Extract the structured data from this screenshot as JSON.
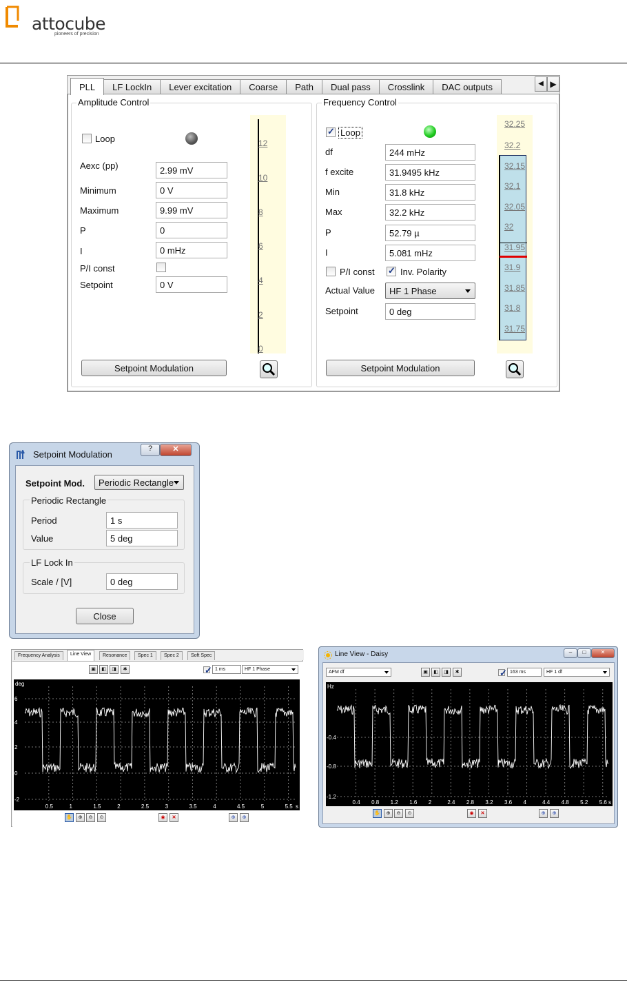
{
  "header": {
    "brand": "attocube",
    "tagline": "pioneers of precision"
  },
  "pll": {
    "tabs": [
      "PLL",
      "LF LockIn",
      "Lever excitation",
      "Coarse",
      "Path",
      "Dual pass",
      "Crosslink",
      "DAC outputs"
    ],
    "amp": {
      "title": "Amplitude Control",
      "loop": "Loop",
      "aexc": "Aexc (pp)",
      "aexc_v": "2.99 mV",
      "min": "Minimum",
      "min_v": "0 V",
      "max": "Maximum",
      "max_v": "9.99 mV",
      "p": "P",
      "p_v": "0",
      "i": "I",
      "i_v": "0 mHz",
      "pic": "P/I const",
      "sp": "Setpoint",
      "sp_v": "0 V",
      "mod_btn": "Setpoint Modulation",
      "scale": [
        "12",
        "10",
        "8",
        "6",
        "4",
        "2",
        "0"
      ]
    },
    "freq": {
      "title": "Frequency Control",
      "loop": "Loop",
      "df": "df",
      "df_v": "244 mHz",
      "fex": "f excite",
      "fex_v": "31.9495 kHz",
      "min": "Min",
      "min_v": "31.8 kHz",
      "max": "Max",
      "max_v": "32.2 kHz",
      "p": "P",
      "p_v": "52.79 µ",
      "i": "I",
      "i_v": "5.081 mHz",
      "pic": "P/I const",
      "inv": "Inv. Polarity",
      "actual": "Actual Value",
      "actual_v": "HF 1 Phase",
      "sp": "Setpoint",
      "sp_v": "0 deg",
      "mod_btn": "Setpoint Modulation",
      "scale": [
        "32.25",
        "32.2",
        "32.15",
        "32.1",
        "32.05",
        "32",
        "31.95",
        "31.9",
        "31.85",
        "31.8",
        "31.75"
      ]
    },
    "colors": {
      "led_amp": "#555555",
      "led_freq": "#22cc22",
      "scale_bg": "#fffce0",
      "range_bg": "#bfe0ea"
    }
  },
  "dialog": {
    "title": "Setpoint Modulation",
    "mod_label": "Setpoint Mod.",
    "mod_v": "Periodic Rectangle",
    "g1": "Periodic Rectangle",
    "period": "Period",
    "period_v": "1 s",
    "value": "Value",
    "value_v": "5 deg",
    "g2": "LF Lock In",
    "scale": "Scale / [V]",
    "scale_v": "0 deg",
    "close": "Close"
  },
  "lv1": {
    "tabs": [
      "Frequency Analysis",
      "Line View",
      "Resonance",
      "Spec 1",
      "Spec 2",
      "Soft Spec"
    ],
    "time": "1 ms",
    "channel": "HF 1 Phase",
    "unit": "deg",
    "yticks": [
      "6",
      "4",
      "2",
      "0",
      "-2"
    ],
    "xticks": [
      "0.5",
      "1",
      "1.5",
      "2",
      "2.5",
      "3",
      "3.5",
      "4",
      "4.5",
      "5",
      "5.5"
    ],
    "xunit": "s"
  },
  "lv2": {
    "title": "Line View - Daisy",
    "source": "AFM df",
    "time": "163 ms",
    "channel": "HF 1 df",
    "unit": "Hz",
    "yticks": [
      "-0.4",
      "-0.8",
      "-1.2"
    ],
    "xticks": [
      "0.4",
      "0.8",
      "1.2",
      "1.6",
      "2",
      "2.4",
      "2.8",
      "3.2",
      "3.6",
      "4",
      "4.4",
      "4.8",
      "5.2",
      "5.6"
    ],
    "xunit": "s"
  }
}
